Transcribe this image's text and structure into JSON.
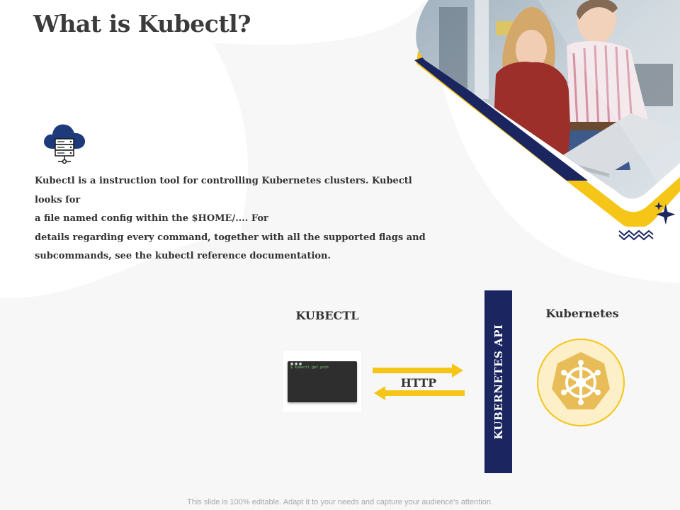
{
  "slide": {
    "title": "What is Kubectl?",
    "description_lines": [
      "Kubectl is a instruction tool for controlling Kubernetes clusters. Kubectl looks for",
      "a file named config within the $HOME/.... For",
      "details regarding every command, together with all the supported flags and",
      "subcommands, see the kubectl reference documentation."
    ],
    "footer": "This slide is 100% editable. Adapt it to your needs and capture your audience's attention."
  },
  "diagram": {
    "client_label": "KUBECTL",
    "terminal_command": "$ kubectl get pods",
    "protocol_label": "HTTP",
    "api_label": "KUBERNETES API",
    "server_label": "Kubernetes"
  },
  "colors": {
    "accent_yellow": "#f5c518",
    "navy": "#1b2660",
    "icon_navy": "#1d3a7a"
  },
  "icons": {
    "cloud": "cloud-server-icon",
    "kubernetes": "kubernetes-helm-icon",
    "sparkle": "sparkle-icon",
    "zigzag": "zigzag-decoration"
  }
}
